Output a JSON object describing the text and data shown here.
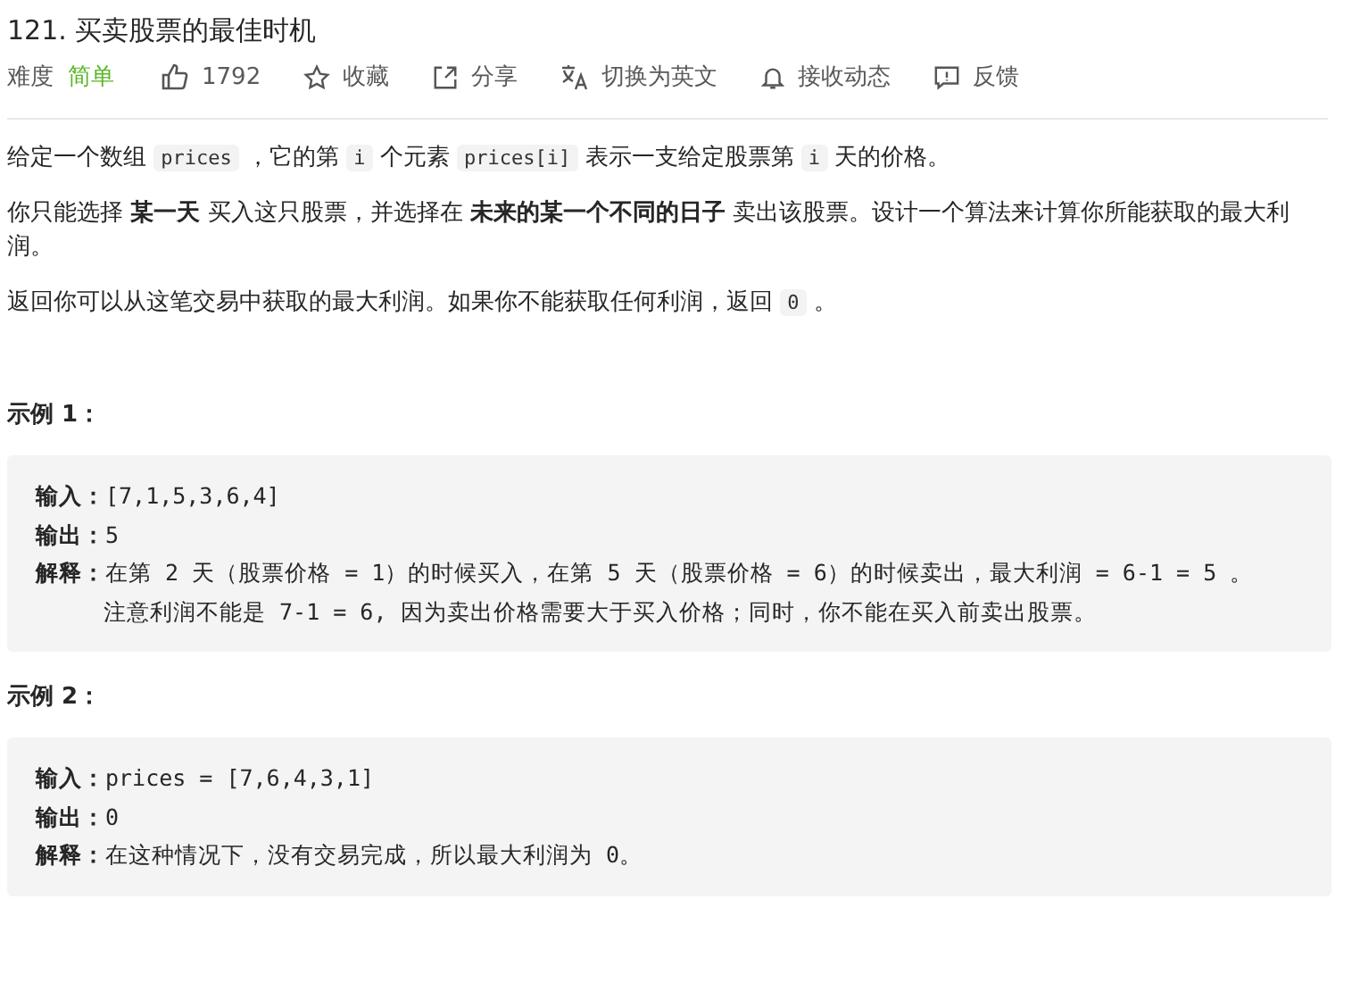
{
  "title": "121. 买卖股票的最佳时机",
  "meta": {
    "difficulty_label": "难度",
    "difficulty": "简单",
    "actions": [
      {
        "kind": "like",
        "label": "1792"
      },
      {
        "kind": "star",
        "label": "收藏"
      },
      {
        "kind": "share",
        "label": "分享"
      },
      {
        "kind": "translate",
        "label": "切换为英文"
      },
      {
        "kind": "bell",
        "label": "接收动态"
      },
      {
        "kind": "feedback",
        "label": "反馈"
      }
    ]
  },
  "paragraphs": [
    [
      {
        "kind": "text",
        "text": "给定一个数组 "
      },
      {
        "kind": "code",
        "text": "prices"
      },
      {
        "kind": "text",
        "text": " ，它的第 "
      },
      {
        "kind": "code",
        "text": "i"
      },
      {
        "kind": "text",
        "text": " 个元素 "
      },
      {
        "kind": "code",
        "text": "prices[i]"
      },
      {
        "kind": "text",
        "text": " 表示一支给定股票第 "
      },
      {
        "kind": "code",
        "text": "i"
      },
      {
        "kind": "text",
        "text": " 天的价格。"
      }
    ],
    [
      {
        "kind": "text",
        "text": "你只能选择 **某一天** 买入这只股票，并选择在 **未来的某一个不同的日子** 卖出该股票。设计一个算法来计算你所能获取的最大利润。"
      }
    ],
    [
      {
        "kind": "text",
        "text": "返回你可以从这笔交易中获取的最大利润。如果你不能获取任何利润，返回 "
      },
      {
        "kind": "code",
        "text": "0"
      },
      {
        "kind": "text",
        "text": " 。"
      }
    ]
  ],
  "examples": [
    {
      "heading": "示例 1：",
      "lines": [
        {
          "kind": "field",
          "label": "输入：",
          "value": "[7,1,5,3,6,4]"
        },
        {
          "kind": "field",
          "label": "输出：",
          "value": "5"
        },
        {
          "kind": "field",
          "label": "解释：",
          "value": "在第 2 天（股票价格 = 1）的时候买入，在第 5 天（股票价格 = 6）的时候卖出，最大利润 = 6-1 = 5 。"
        },
        {
          "kind": "note",
          "value": "注意利润不能是 7-1 = 6, 因为卖出价格需要大于买入价格；同时，你不能在买入前卖出股票。"
        }
      ]
    },
    {
      "heading": "示例 2：",
      "lines": [
        {
          "kind": "field",
          "label": "输入：",
          "value": "prices = [7,6,4,3,1]"
        },
        {
          "kind": "field",
          "label": "输出：",
          "value": "0"
        },
        {
          "kind": "field",
          "label": "解释：",
          "value": "在这种情况下，没有交易完成，所以最大利润为 0。"
        }
      ]
    }
  ]
}
